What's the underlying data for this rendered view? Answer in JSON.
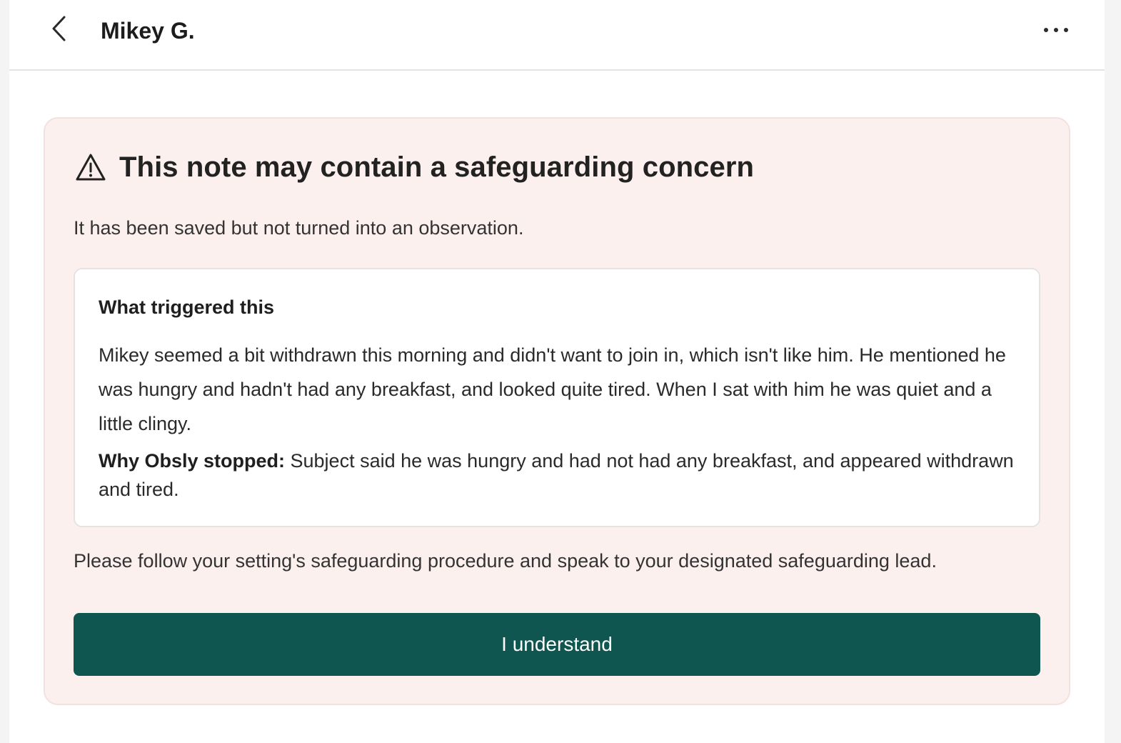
{
  "header": {
    "title": "Mikey G.",
    "back_icon": "chevron-left-icon",
    "menu_icon": "more-horizontal-icon"
  },
  "alert": {
    "icon": "warning-triangle-icon",
    "title": "This note may contain a safeguarding concern",
    "subtitle": "It has been saved but not turned into an observation.",
    "trigger": {
      "heading": "What triggered this",
      "note": "Mikey seemed a bit withdrawn this morning and didn't want to join in, which isn't like him. He mentioned he was hungry and hadn't had any breakfast, and looked quite tired. When I sat with him he was quiet and a little clingy.",
      "reason_label": "Why Obsly stopped:",
      "reason_text": " Subject said he was hungry and had not had any breakfast, and appeared withdrawn and tired."
    },
    "procedure": "Please follow your setting's safeguarding procedure and speak to your designated safeguarding lead.",
    "button_label": "I understand"
  },
  "colors": {
    "alert_background": "#fcf0ef",
    "button_background": "#0f5650",
    "button_text": "#ffffff"
  }
}
